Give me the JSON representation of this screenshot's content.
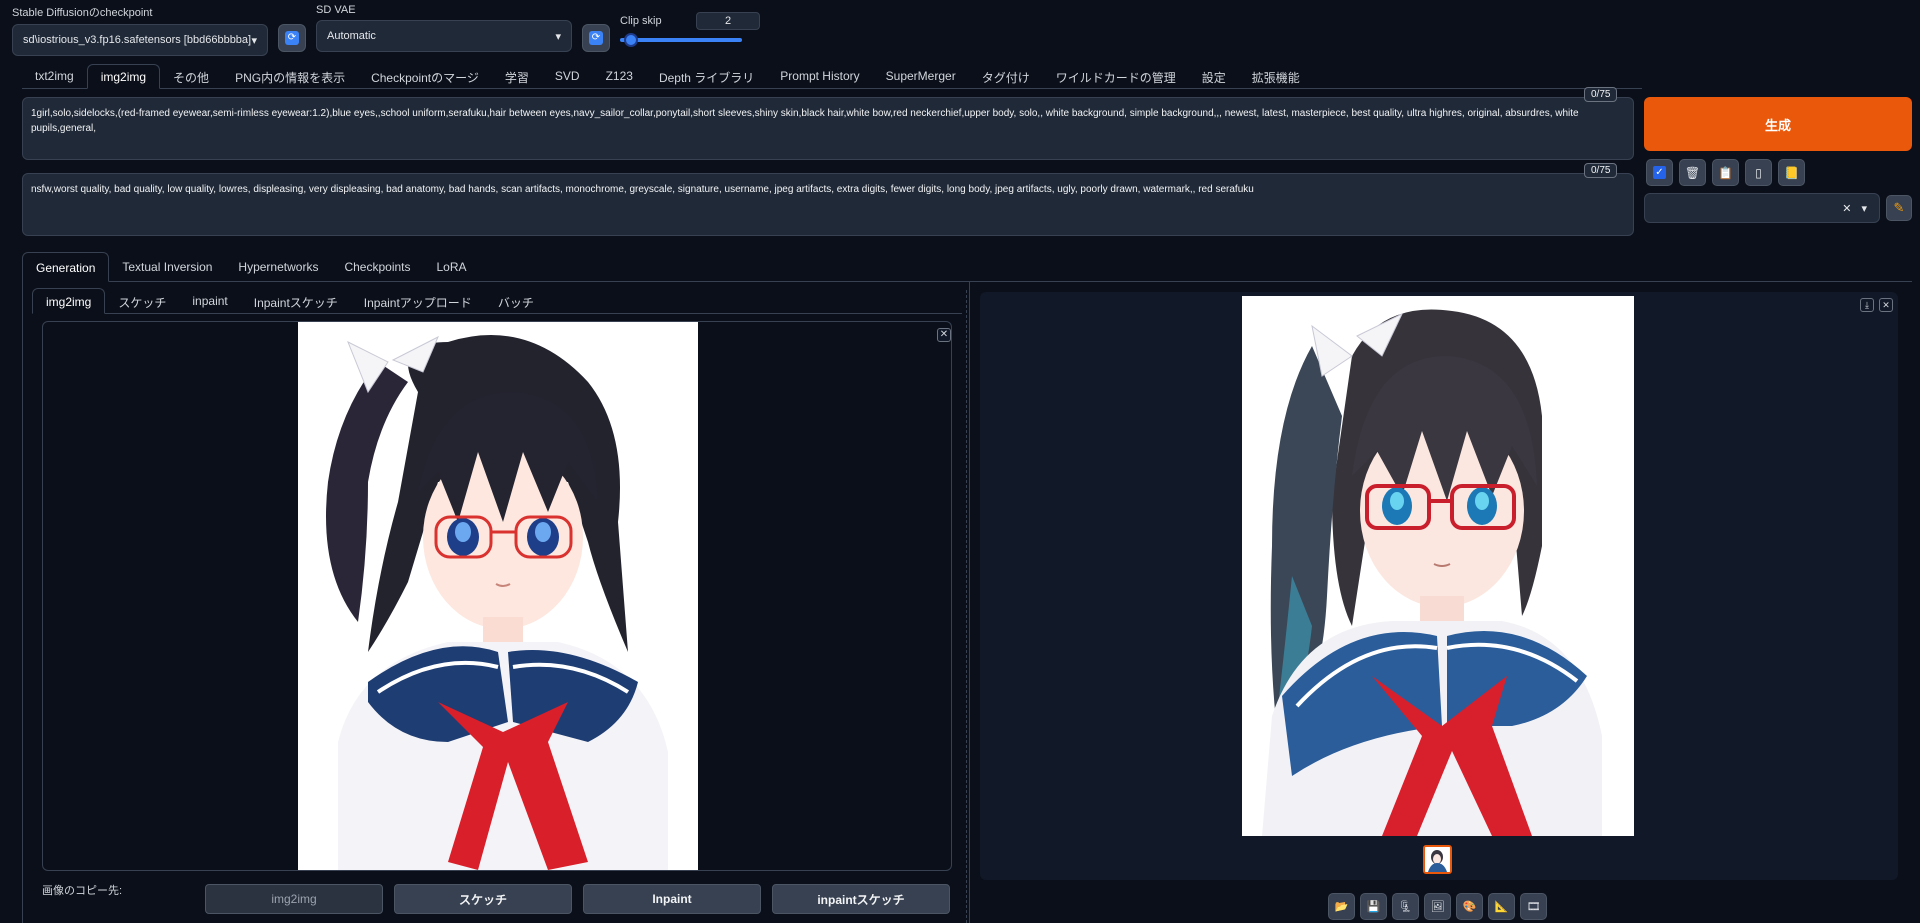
{
  "checkpoint": {
    "label": "Stable Diffusionのcheckpoint",
    "value": "sd\\iostrious_v3.fp16.safetensors [bbd66bbbba]"
  },
  "vae": {
    "label": "SD VAE",
    "value": "Automatic"
  },
  "clip_skip": {
    "label": "Clip skip",
    "value": "2",
    "fraction": 0.08
  },
  "tabs": [
    "txt2img",
    "img2img",
    "その他",
    "PNG内の情報を表示",
    "Checkpointのマージ",
    "学習",
    "SVD",
    "Z123",
    "Depth ライブラリ",
    "Prompt History",
    "SuperMerger",
    "タグ付け",
    "ワイルドカードの管理",
    "設定",
    "拡張機能"
  ],
  "active_tab": "img2img",
  "prompt": {
    "positive": "1girl,solo,sidelocks,(red-framed eyewear,semi-rimless eyewear:1.2),blue eyes,,school uniform,serafuku,hair between eyes,navy_sailor_collar,ponytail,short sleeves,shiny skin,black hair,white bow,red neckerchief,upper body, solo,, white background, simple background,,, newest, latest, masterpiece, best quality, ultra highres, original, absurdres, white pupils,general,",
    "positive_counter": "0/75",
    "negative": "nsfw,worst quality, bad quality, low quality, lowres, displeasing, very displeasing, bad anatomy, bad hands, scan artifacts, monochrome, greyscale, signature, username, jpeg artifacts,  extra digits, fewer digits, long body, jpeg artifacts, ugly, poorly drawn, watermark,, red serafuku",
    "negative_counter": "0/75"
  },
  "generate_label": "生成",
  "subtabs": [
    "Generation",
    "Textual Inversion",
    "Hypernetworks",
    "Checkpoints",
    "LoRA"
  ],
  "image_tabs": [
    "img2img",
    "スケッチ",
    "inpaint",
    "Inpaintスケッチ",
    "Inpaintアップロード",
    "バッチ"
  ],
  "copy": {
    "label": "画像のコピー先:",
    "buttons": [
      "img2img",
      "スケッチ",
      "Inpaint",
      "inpaintスケッチ"
    ]
  },
  "icons": {
    "refresh": "refresh-icon",
    "tools": [
      "checkbox-icon",
      "trash-icon",
      "clipboard-icon",
      "phone-icon",
      "notebook-icon"
    ],
    "bottom_tools": [
      "folder-icon",
      "save-icon",
      "archive-icon",
      "image-icon",
      "palette-icon",
      "ruler-icon",
      "film-icon"
    ]
  },
  "colors": {
    "accent": "#ea580c",
    "blue": "#3b82f6",
    "bg": "#0b0f19",
    "panel": "#1f2937"
  }
}
